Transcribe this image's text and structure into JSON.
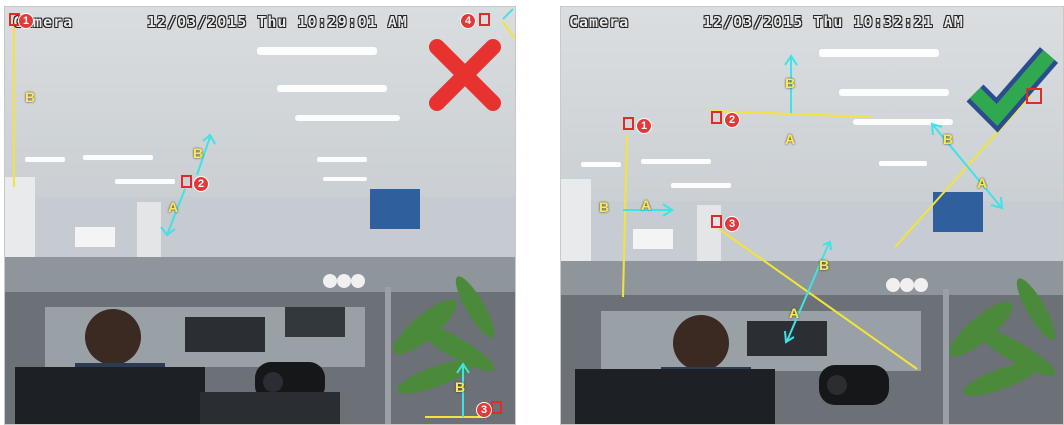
{
  "left_panel": {
    "camera_label": "Camera",
    "datetime": "12/03/2015 Thu 10:29:01 AM",
    "verdict_icon": "red-x-icon",
    "verdict_color": "#e8322f",
    "labels": {
      "b_left": "B",
      "b_arrow": "B",
      "a_arrow": "A",
      "b_bottom": "B"
    },
    "markers": [
      "1",
      "2",
      "3",
      "4"
    ]
  },
  "right_panel": {
    "camera_label": "Camera",
    "datetime": "12/03/2015 Thu 10:32:21 AM",
    "verdict_icon": "green-check-icon",
    "verdict_color": "#2fa84f",
    "labels": {
      "b_top": "B",
      "a_top": "A",
      "b_left": "B",
      "a_left": "A",
      "b_right": "B",
      "a_right": "A",
      "b_center": "B",
      "a_center": "A"
    },
    "markers": [
      "1",
      "2",
      "3"
    ]
  },
  "colors": {
    "line_yellow": "#f2e43a",
    "arrow_cyan": "#3fe3e6",
    "marker_red": "#e02b2b"
  }
}
